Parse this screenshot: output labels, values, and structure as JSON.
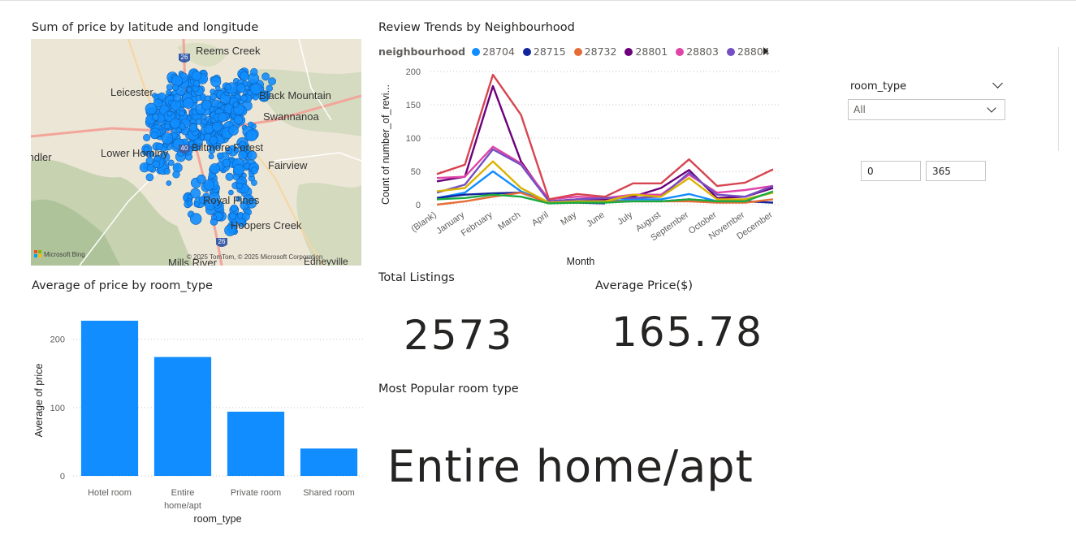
{
  "map_visual": {
    "title": "Sum of price by latitude and longitude",
    "place_labels": [
      "Reems Creek",
      "Leicester",
      "Black Mountain",
      "Swannanoa",
      "Lower Hominy",
      "Candler",
      "Fairview",
      "Biltmore Forest",
      "Royal Pines",
      "Hoopers Creek",
      "Mills River",
      "Edneyville"
    ],
    "road_shields": [
      "26",
      "40",
      "26"
    ],
    "attribution": "© 2025 TomTom, © 2025 Microsoft Corporation",
    "provider": "Microsoft Bing",
    "colors": {
      "bubble": "#118dff",
      "bubble_stroke": "#0a5fb3"
    }
  },
  "line_visual": {
    "title": "Review Trends by Neighbourhood",
    "legend_title": "neighbourhood",
    "legend": [
      {
        "name": "28704",
        "color": "#118dff"
      },
      {
        "name": "28715",
        "color": "#12239e"
      },
      {
        "name": "28732",
        "color": "#e66c37"
      },
      {
        "name": "28801",
        "color": "#6b007b"
      },
      {
        "name": "28803",
        "color": "#e044a7"
      },
      {
        "name": "28804",
        "color": "#744ec2"
      }
    ],
    "xlabel": "Month",
    "ylabel": "Count of number_of_revi..."
  },
  "bar_visual": {
    "title": "Average of price by room_type"
  },
  "cards": {
    "total_listings_title": "Total Listings",
    "total_listings_value": "2573",
    "avg_price_title": "Average Price($)",
    "avg_price_value": "165.78",
    "popular_title": "Most Popular room type",
    "popular_value": "Entire home/apt"
  },
  "slicer": {
    "label": "room_type",
    "selected": "All",
    "range_min": "0",
    "range_max": "365"
  },
  "chart_data": [
    {
      "type": "line",
      "title": "Review Trends by Neighbourhood",
      "xlabel": "Month",
      "ylabel": "Count of number_of_revi...",
      "ylim": [
        0,
        200
      ],
      "yticks": [
        0,
        50,
        100,
        150,
        200
      ],
      "categories": [
        "(Blank)",
        "January",
        "February",
        "March",
        "April",
        "May",
        "June",
        "July",
        "August",
        "September",
        "October",
        "November",
        "December"
      ],
      "grid": true,
      "series": [
        {
          "name": "28704",
          "color": "#118dff",
          "values": [
            10,
            18,
            50,
            20,
            3,
            5,
            5,
            8,
            8,
            16,
            5,
            8,
            18
          ]
        },
        {
          "name": "28715",
          "color": "#12239e",
          "values": [
            10,
            15,
            17,
            18,
            3,
            3,
            2,
            null,
            5,
            8,
            5,
            5,
            3
          ]
        },
        {
          "name": "28732",
          "color": "#e66c37",
          "values": [
            0,
            5,
            12,
            18,
            3,
            3,
            5,
            5,
            5,
            5,
            3,
            3,
            8
          ]
        },
        {
          "name": "28801",
          "color": "#6b007b",
          "values": [
            35,
            42,
            178,
            65,
            5,
            8,
            8,
            12,
            25,
            52,
            10,
            12,
            25
          ]
        },
        {
          "name": "28803",
          "color": "#e044a7",
          "values": [
            40,
            42,
            87,
            62,
            8,
            12,
            10,
            15,
            15,
            45,
            18,
            22,
            28
          ]
        },
        {
          "name": "28804",
          "color": "#744ec2",
          "values": [
            18,
            30,
            83,
            60,
            5,
            8,
            10,
            10,
            12,
            48,
            15,
            12,
            28
          ]
        },
        {
          "name": "",
          "color": "#d9b300",
          "values": [
            20,
            25,
            65,
            25,
            3,
            5,
            5,
            15,
            12,
            40,
            8,
            8,
            18
          ]
        },
        {
          "name": "",
          "color": "#d64550",
          "values": [
            46,
            60,
            195,
            135,
            8,
            16,
            12,
            32,
            32,
            68,
            28,
            33,
            53
          ]
        },
        {
          "name": "",
          "color": "#1aab40",
          "values": [
            8,
            10,
            15,
            12,
            2,
            3,
            3,
            5,
            5,
            8,
            5,
            5,
            20
          ]
        }
      ]
    },
    {
      "type": "bar",
      "title": "Average of price by room_type",
      "xlabel": "room_type",
      "ylabel": "Average of price",
      "ylim": [
        0,
        240
      ],
      "yticks": [
        0,
        100,
        200
      ],
      "grid": true,
      "categories": [
        "Hotel room",
        "Entire home/apt",
        "Private room",
        "Shared room"
      ],
      "category_lines": [
        [
          "Hotel room"
        ],
        [
          "Entire",
          "home/apt"
        ],
        [
          "Private room"
        ],
        [
          "Shared room"
        ]
      ],
      "values": [
        227,
        174,
        94,
        40
      ],
      "color": "#118dff"
    }
  ]
}
